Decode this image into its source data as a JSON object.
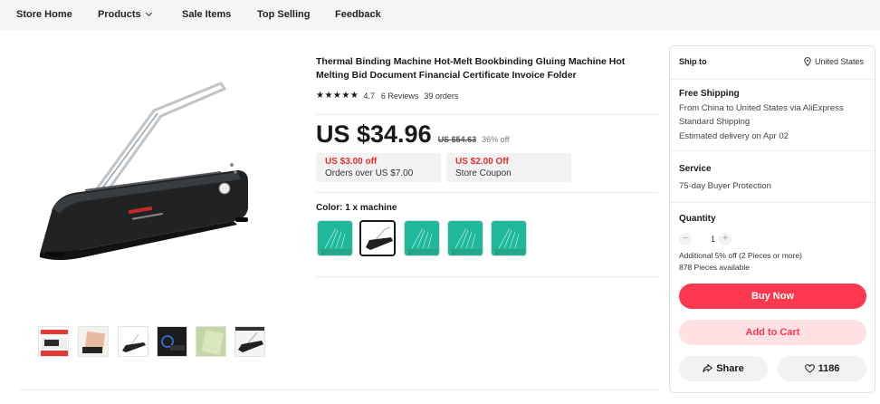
{
  "nav": {
    "store_home": "Store Home",
    "products": "Products",
    "sale_items": "Sale Items",
    "top_selling": "Top Selling",
    "feedback": "Feedback"
  },
  "product": {
    "title": "Thermal Binding Machine Hot-Melt Bookbinding Gluing Machine Hot Melting Bid Document Financial Certificate Invoice Folder",
    "stars": "★★★★★",
    "rating": "4.7",
    "reviews": "6 Reviews",
    "orders": "39 orders",
    "price": "US $34.96",
    "old_price": "US $54.63",
    "discount": "36% off",
    "coupons": [
      {
        "off": "US $3.00 off",
        "desc": "Orders over US $7.00"
      },
      {
        "off": "US $2.00 Off",
        "desc": "Store Coupon"
      }
    ],
    "color_label": "Color: 1 x machine",
    "selected_swatch": 1
  },
  "purchase": {
    "ship_to_label": "Ship to",
    "ship_to_value": "United States",
    "free_shipping": "Free Shipping",
    "shipping_line1": "From China to United States via AliExpress",
    "shipping_line2": "Standard Shipping",
    "delivery": "Estimated delivery on Apr 02",
    "service_label": "Service",
    "service_value": "75-day Buyer Protection",
    "quantity_label": "Quantity",
    "quantity": "1",
    "minus": "−",
    "plus": "+",
    "extra_discount": "Additional 5% off (2 Pieces or more)",
    "available": "878 Pieces available",
    "buy_now": "Buy Now",
    "add_to_cart": "Add to Cart",
    "share": "Share",
    "likes": "1186"
  },
  "colors": {
    "accent": "#fd384f",
    "accent_light": "#ffe1e4",
    "coupon_red": "#e62e2e",
    "swatch_teal": "#1fb89a"
  },
  "icons": {
    "pin": "map-pin-icon",
    "share": "share-icon",
    "heart": "heart-icon",
    "chevron": "chevron-down-icon"
  }
}
